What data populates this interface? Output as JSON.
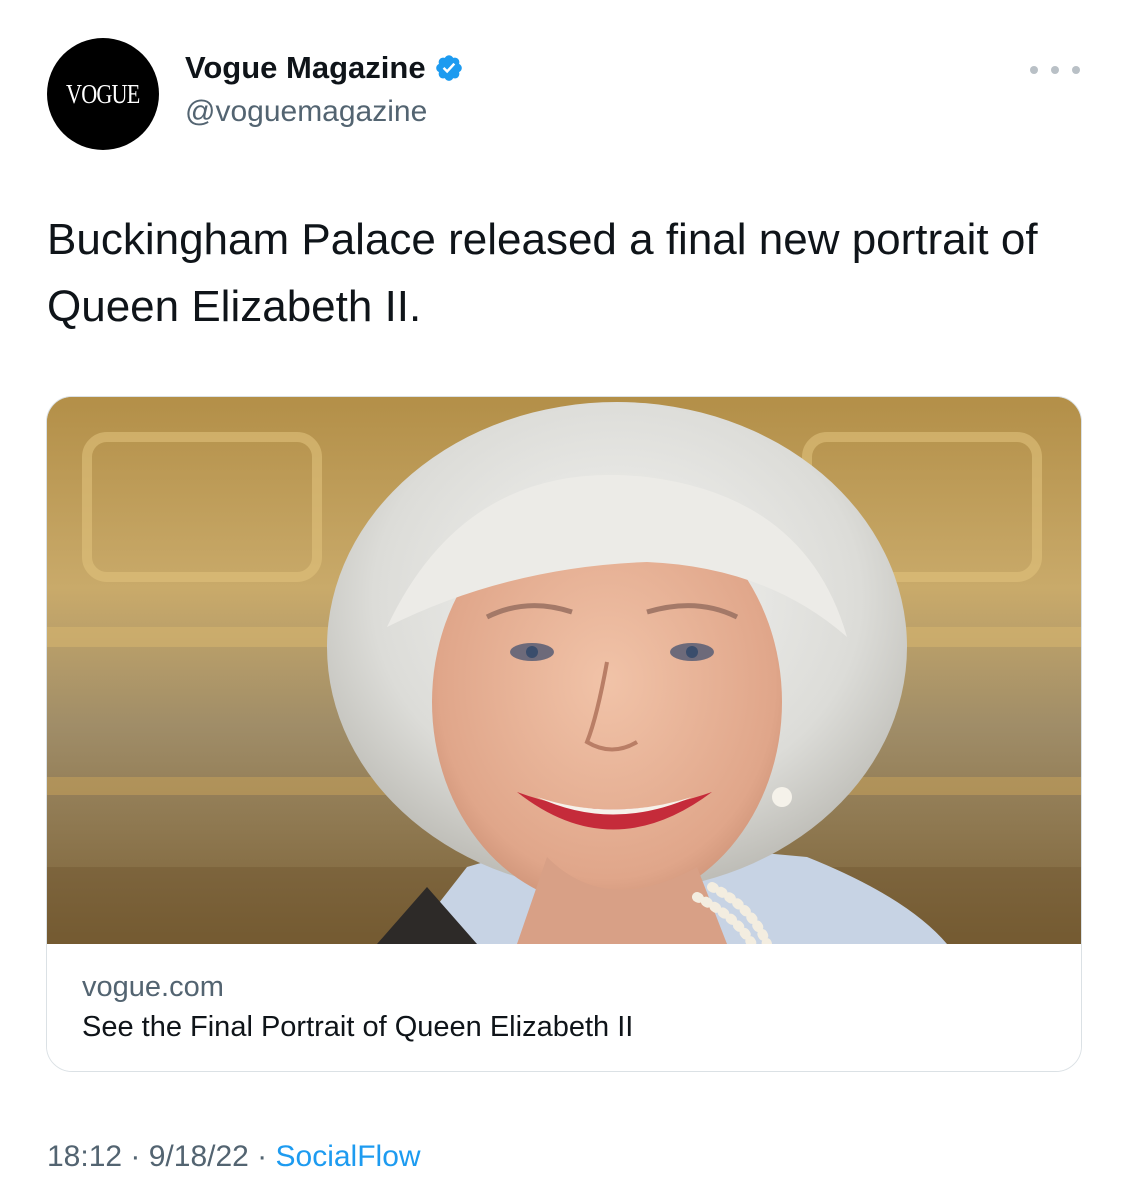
{
  "author": {
    "avatar_text": "VOGUE",
    "display_name": "Vogue Magazine",
    "handle": "@voguemagazine",
    "verified": true
  },
  "tweet": {
    "text": "Buckingham Palace released a final new portrait of Queen Elizabeth II."
  },
  "card": {
    "domain": "vogue.com",
    "title": "See the Final Portrait of Queen Elizabeth II"
  },
  "meta": {
    "time": "18:12",
    "separator": " · ",
    "date": "9/18/22",
    "source": "SocialFlow"
  },
  "colors": {
    "accent": "#1d9bf0",
    "secondary_text": "#536471",
    "primary_text": "#0f1419"
  },
  "icons": {
    "verified": "verified-badge-icon",
    "more": "more-options-icon"
  }
}
